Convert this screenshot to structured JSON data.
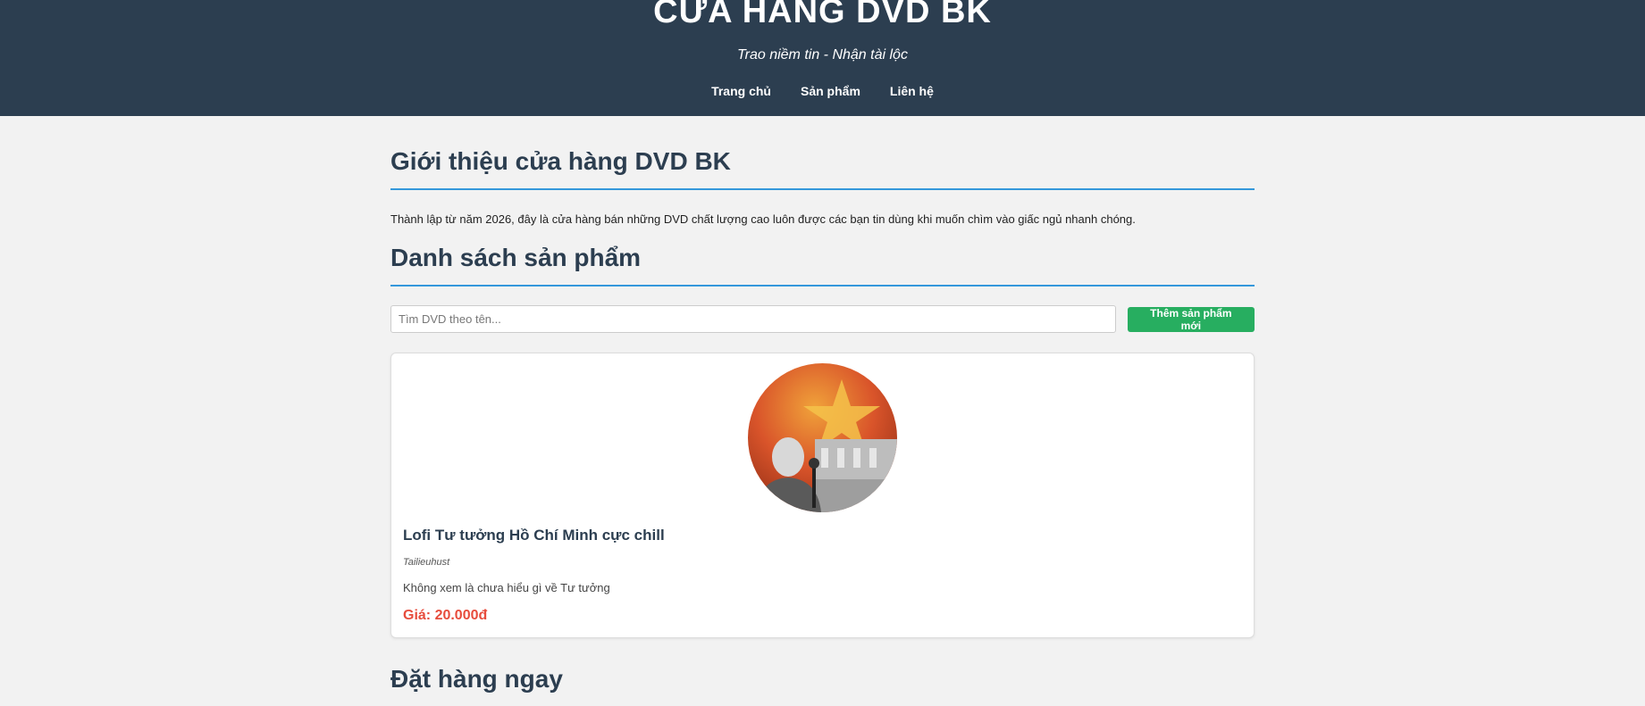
{
  "header": {
    "title": "CỬA HÀNG DVD BK",
    "tagline": "Trao niềm tin - Nhận tài lộc",
    "nav": [
      "Trang chủ",
      "Sản phẩm",
      "Liên hệ"
    ]
  },
  "intro": {
    "title": "Giới thiệu cửa hàng DVD BK",
    "text": "Thành lập từ năm 2026, đây là cửa hàng bán những DVD chất lượng cao luôn được các bạn tin dùng khi muốn chìm vào giấc ngủ nhanh chóng."
  },
  "products_section": {
    "title": "Danh sách sản phẩm",
    "search_placeholder": "Tìm DVD theo tên...",
    "add_button": "Thêm sản phẩm mới",
    "items": [
      {
        "name": "Lofi Tư tưởng Hồ Chí Minh cực chill",
        "author": "Tailieuhust",
        "description": "Không xem là chưa hiểu gì về Tư tưởng",
        "price": "Giá: 20.000đ"
      }
    ]
  },
  "order_section": {
    "title": "Đặt hàng ngay"
  },
  "colors": {
    "header_bg": "#2c3e50",
    "accent_blue": "#3498db",
    "button_green": "#27ae60",
    "price_red": "#e74c3c"
  }
}
